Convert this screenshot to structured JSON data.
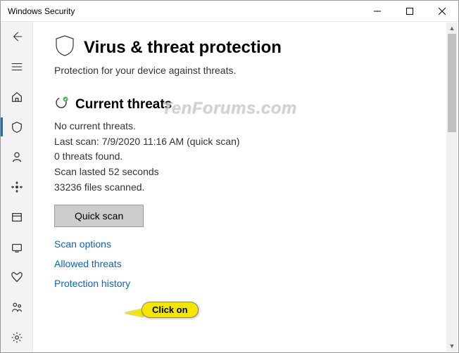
{
  "window": {
    "title": "Windows Security"
  },
  "page": {
    "title": "Virus & threat protection",
    "subtitle": "Protection for your device against threats."
  },
  "currentThreats": {
    "heading": "Current threats",
    "status": "No current threats.",
    "lastScan": "Last scan: 7/9/2020 11:16 AM (quick scan)",
    "threatsFound": "0 threats found.",
    "duration": "Scan lasted 52 seconds",
    "filesScanned": "33236 files scanned."
  },
  "actions": {
    "quickScan": "Quick scan",
    "scanOptions": "Scan options",
    "allowedThreats": "Allowed threats",
    "protectionHistory": "Protection history"
  },
  "annotation": {
    "callout": "Click on"
  },
  "watermark": "TenForums.com"
}
